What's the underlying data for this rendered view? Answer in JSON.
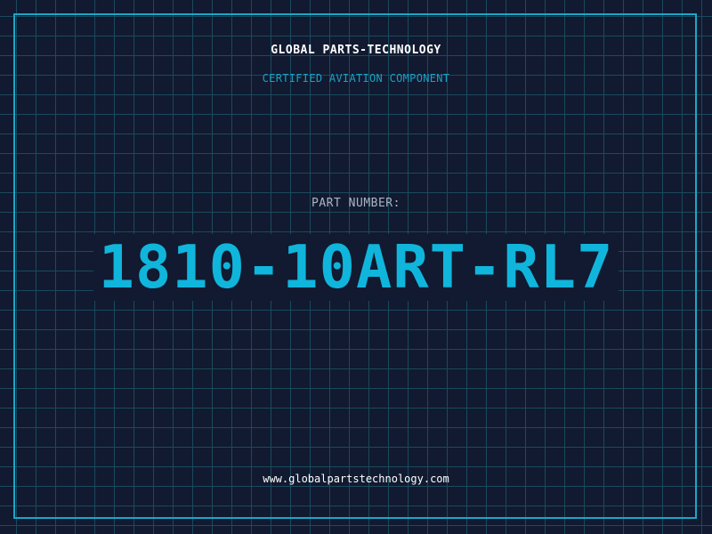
{
  "header": {
    "company": "GLOBAL PARTS-TECHNOLOGY",
    "subtitle": "CERTIFIED AVIATION COMPONENT"
  },
  "part": {
    "label": "PART NUMBER:",
    "number": "1810-10ART-RL7"
  },
  "footer": {
    "url": "www.globalpartstechnology.com"
  },
  "colors": {
    "background": "#111a30",
    "grid": "#1a4a5c",
    "frame": "#19a7c8",
    "accent": "#10b5dc",
    "subtitle": "#1ba0c6",
    "label": "#aab4c4",
    "text": "#ffffff"
  }
}
